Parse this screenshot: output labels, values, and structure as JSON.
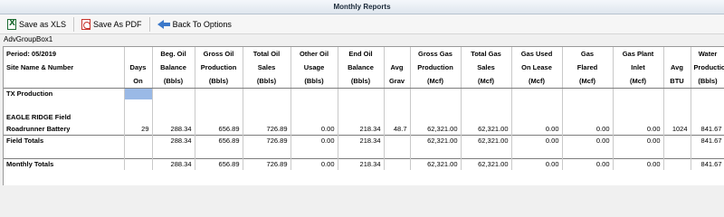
{
  "window": {
    "title": "Monthly Reports"
  },
  "toolbar": {
    "save_xls": "Save as XLS",
    "save_pdf": "Save As PDF",
    "back": "Back To Options"
  },
  "groupbox": {
    "label": "AdvGroupBox1"
  },
  "report": {
    "period": "Period: 05/2019",
    "site_header": "Site Name & Number",
    "columns": [
      {
        "l1": "",
        "l2": "Days",
        "l3": "On"
      },
      {
        "l1": "Beg. Oil",
        "l2": "Balance",
        "l3": "(Bbls)"
      },
      {
        "l1": "Gross Oil",
        "l2": "Production",
        "l3": "(Bbls)"
      },
      {
        "l1": "Total Oil",
        "l2": "Sales",
        "l3": "(Bbls)"
      },
      {
        "l1": "Other Oil",
        "l2": "Usage",
        "l3": "(Bbls)"
      },
      {
        "l1": "End Oil",
        "l2": "Balance",
        "l3": "(Bbls)"
      },
      {
        "l1": "",
        "l2": "Avg",
        "l3": "Grav"
      },
      {
        "l1": "Gross Gas",
        "l2": "Production",
        "l3": "(Mcf)"
      },
      {
        "l1": "Total Gas",
        "l2": "Sales",
        "l3": "(Mcf)"
      },
      {
        "l1": "Gas Used",
        "l2": "On Lease",
        "l3": "(Mcf)"
      },
      {
        "l1": "Gas",
        "l2": "Flared",
        "l3": "(Mcf)"
      },
      {
        "l1": "Gas Plant",
        "l2": "Inlet",
        "l3": "(Mcf)"
      },
      {
        "l1": "",
        "l2": "Avg",
        "l3": "BTU"
      },
      {
        "l1": "Water",
        "l2": "Production",
        "l3": "(Bbls)"
      }
    ],
    "rows": {
      "tx_production": "TX Production",
      "field": "EAGLE RIDGE Field",
      "battery": {
        "name": "Roadrunner Battery",
        "values": [
          "29",
          "288.34",
          "656.89",
          "726.89",
          "0.00",
          "218.34",
          "48.7",
          "62,321.00",
          "62,321.00",
          "0.00",
          "0.00",
          "0.00",
          "1024",
          "841.67"
        ]
      },
      "field_totals": {
        "name": "Field Totals",
        "values": [
          "",
          "288.34",
          "656.89",
          "726.89",
          "0.00",
          "218.34",
          "",
          "62,321.00",
          "62,321.00",
          "0.00",
          "0.00",
          "0.00",
          "",
          "841.67"
        ]
      },
      "monthly_totals": {
        "name": "Monthly Totals",
        "values": [
          "",
          "288.34",
          "656.89",
          "726.89",
          "0.00",
          "218.34",
          "",
          "62,321.00",
          "62,321.00",
          "0.00",
          "0.00",
          "0.00",
          "",
          "841.67"
        ]
      }
    }
  }
}
